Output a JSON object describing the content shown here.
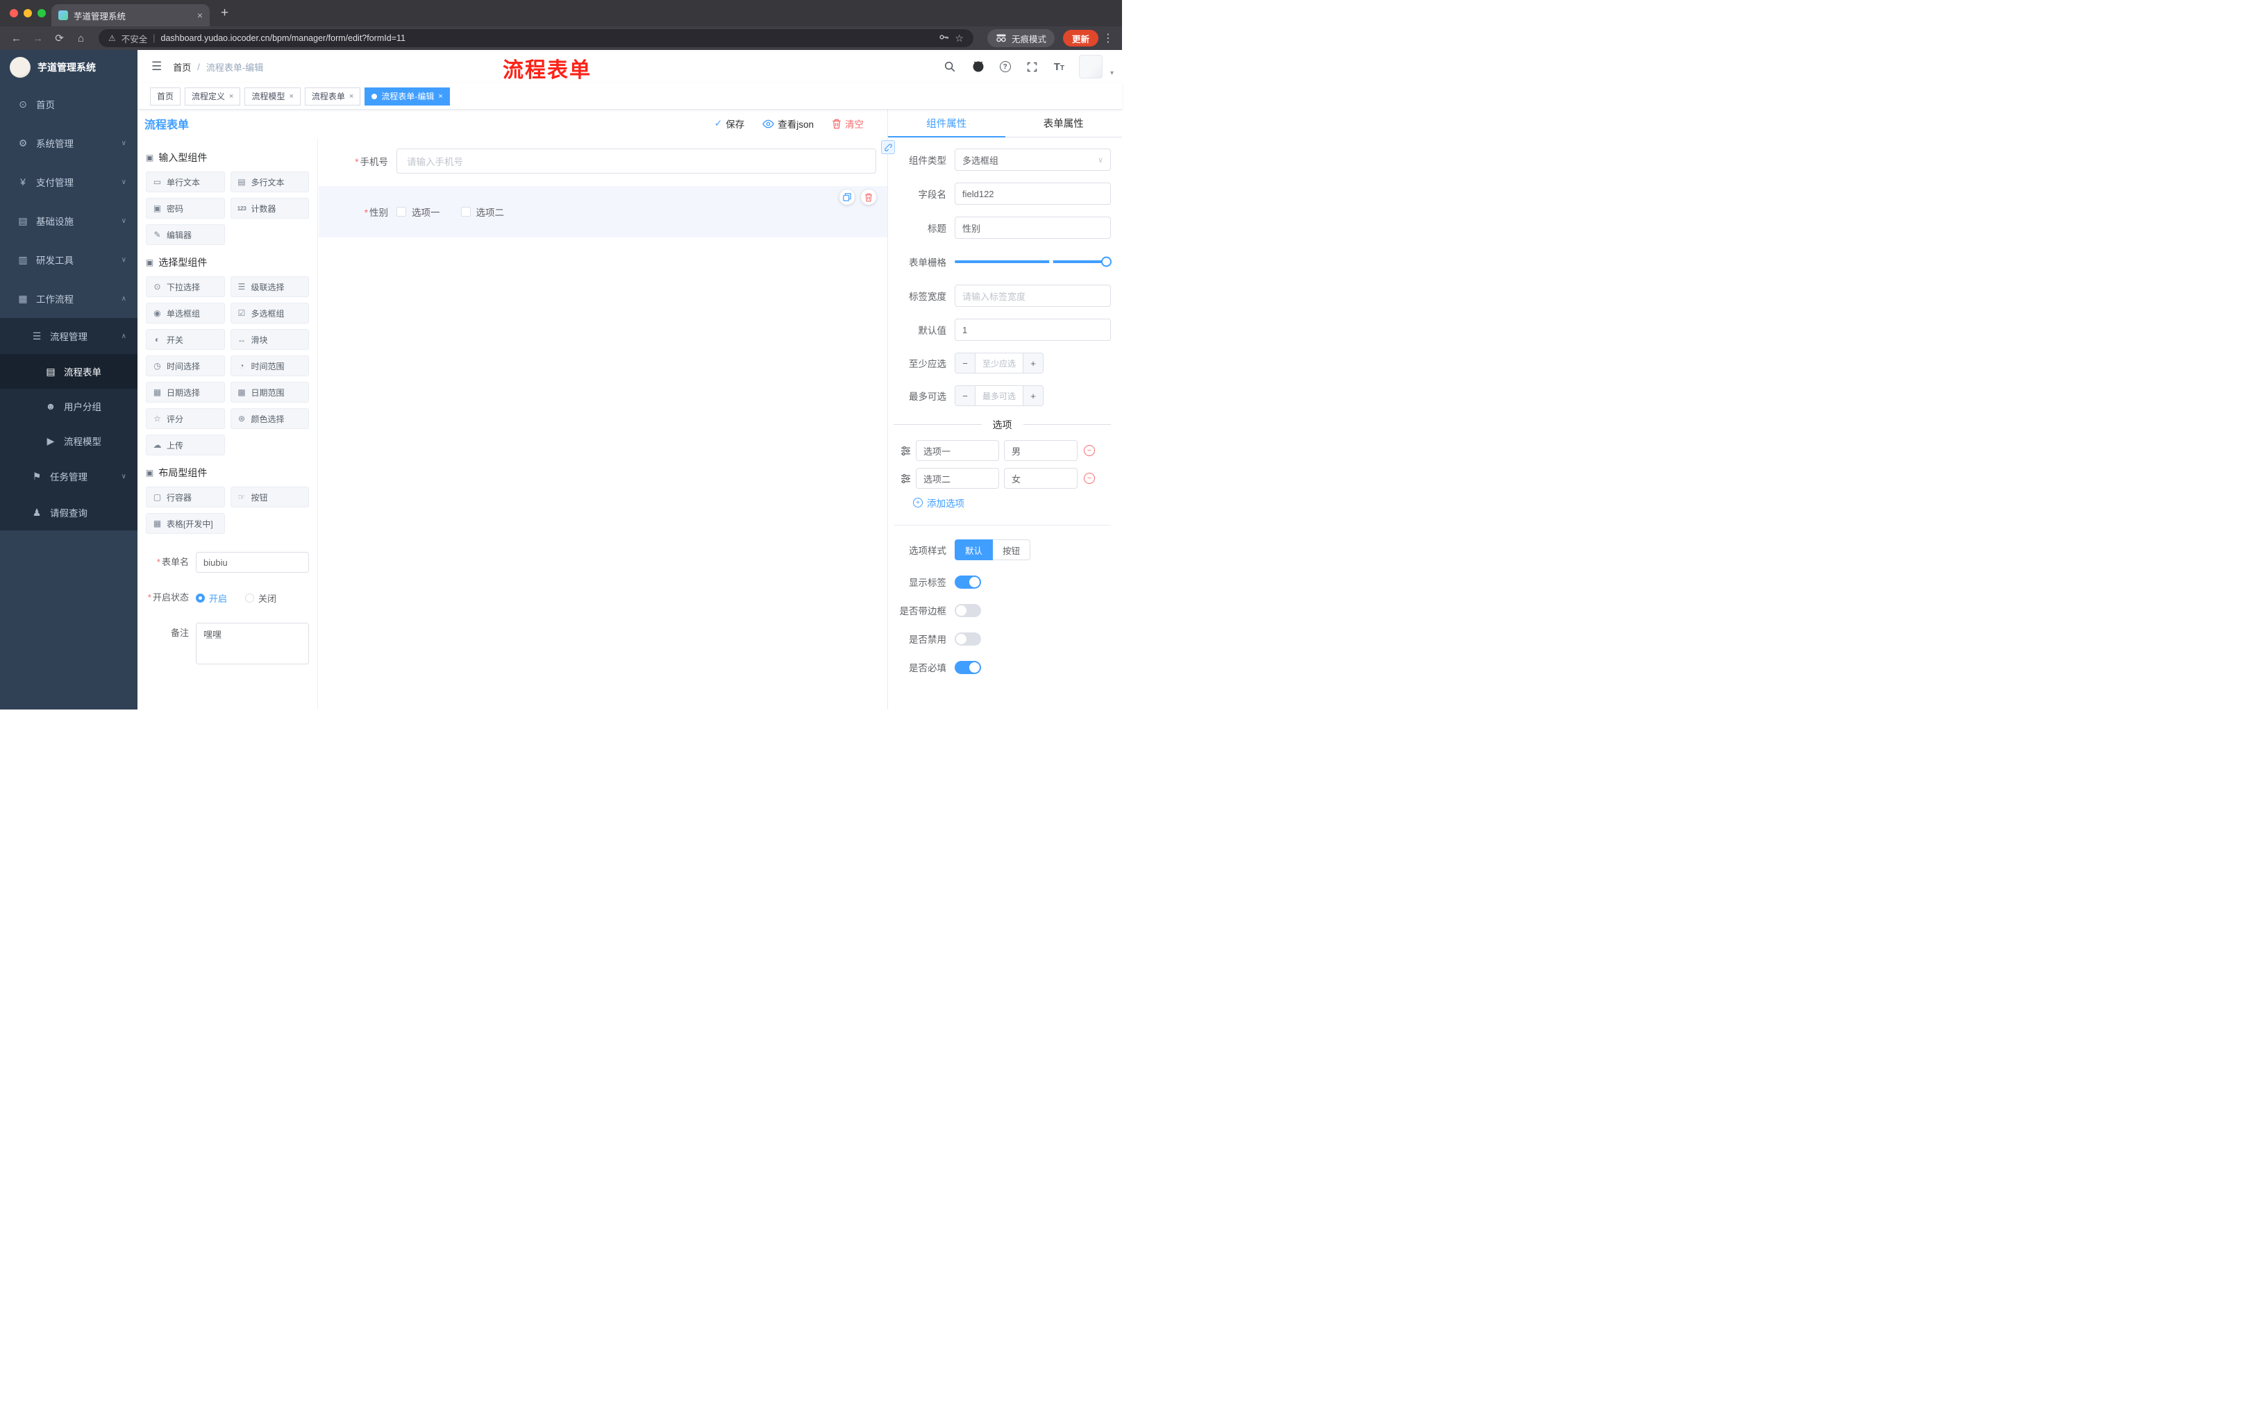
{
  "colors": {
    "accent": "#409eff",
    "danger": "#f56c6c",
    "annotation_red": "#fb2318",
    "sidebar_bg": "#304156"
  },
  "marks": {
    "required": "*",
    "minus": "−",
    "plus": "+",
    "close": "×",
    "pipe": "|",
    "chevron": "∨",
    "caret": "▾",
    "sep": "/"
  },
  "annotation": {
    "text": "流程表单"
  },
  "browser": {
    "tab_title": "芋道管理系统",
    "new_tab": "+",
    "back": "←",
    "forward": "→",
    "reload": "⟳",
    "home": "⌂",
    "warning_icon": "⚠",
    "warning_text": "不安全",
    "url": "dashboard.yudao.iocoder.cn/bpm/manager/form/edit?formId=11",
    "star": "☆",
    "incognito": "无痕模式",
    "update": "更新",
    "menu_dots": "⋮"
  },
  "sidebar": {
    "logo_title": "芋道管理系统",
    "items": [
      {
        "icon": "⊙",
        "label": "首页",
        "arrow": ""
      },
      {
        "icon": "⚙",
        "label": "系统管理",
        "arrow": "∨"
      },
      {
        "icon": "¥",
        "label": "支付管理",
        "arrow": "∨"
      },
      {
        "icon": "▤",
        "label": "基础设施",
        "arrow": "∨"
      },
      {
        "icon": "▥",
        "label": "研发工具",
        "arrow": "∨"
      },
      {
        "icon": "▦",
        "label": "工作流程",
        "arrow": "∧"
      },
      {
        "icon": "☰",
        "label": "流程管理",
        "arrow": "∧"
      },
      {
        "icon": "▤",
        "label": "流程表单",
        "arrow": ""
      },
      {
        "icon": "☻",
        "label": "用户分组",
        "arrow": ""
      },
      {
        "icon": "▶",
        "label": "流程模型",
        "arrow": ""
      },
      {
        "icon": "⚑",
        "label": "任务管理",
        "arrow": "∨"
      },
      {
        "icon": "♟",
        "label": "请假查询",
        "arrow": ""
      }
    ]
  },
  "header": {
    "hamburger": "☰",
    "breadcrumb_home": "首页",
    "breadcrumb_current": "流程表单-编辑",
    "help": "?",
    "font_big": "T",
    "font_small": "T"
  },
  "chips": [
    {
      "label": "首页"
    },
    {
      "label": "流程定义"
    },
    {
      "label": "流程模型"
    },
    {
      "label": "流程表单"
    },
    {
      "label": "流程表单-编辑"
    }
  ],
  "toolbar": {
    "title": "流程表单",
    "save_icon": "✓",
    "save": "保存",
    "view_json": "查看json",
    "clear": "清空"
  },
  "palette": {
    "sections": [
      {
        "title": "输入型组件",
        "items": [
          {
            "icon": "▭",
            "label": "单行文本"
          },
          {
            "icon": "▤",
            "label": "多行文本"
          },
          {
            "icon": "▣",
            "label": "密码"
          },
          {
            "icon": "123",
            "label": "计数器"
          },
          {
            "icon": "✎",
            "label": "编辑器"
          }
        ]
      },
      {
        "title": "选择型组件",
        "items": [
          {
            "icon": "⊙",
            "label": "下拉选择"
          },
          {
            "icon": "☰",
            "label": "级联选择"
          },
          {
            "icon": "◉",
            "label": "单选框组"
          },
          {
            "icon": "☑",
            "label": "多选框组"
          },
          {
            "icon": "◐",
            "label": "开关"
          },
          {
            "icon": "↔",
            "label": "滑块"
          },
          {
            "icon": "◷",
            "label": "时间选择"
          },
          {
            "icon": "◔",
            "label": "时间范围"
          },
          {
            "icon": "▦",
            "label": "日期选择"
          },
          {
            "icon": "▩",
            "label": "日期范围"
          },
          {
            "icon": "☆",
            "label": "评分"
          },
          {
            "icon": "⊛",
            "label": "颜色选择"
          },
          {
            "icon": "☁",
            "label": "上传"
          }
        ]
      },
      {
        "title": "布局型组件",
        "items": [
          {
            "icon": "▢",
            "label": "行容器"
          },
          {
            "icon": "☞",
            "label": "按钮"
          },
          {
            "icon": "▦",
            "label": "表格[开发中]"
          }
        ]
      }
    ]
  },
  "form_meta": {
    "name_label": "表单名",
    "name_value": "biubiu",
    "status_label": "开启状态",
    "status_on": "开启",
    "status_off": "关闭",
    "remark_label": "备注",
    "remark_value": "嘿嘿"
  },
  "canvas": {
    "phone_label": "手机号",
    "phone_placeholder": "请输入手机号",
    "gender_label": "性别",
    "gender_opt1": "选项一",
    "gender_opt2": "选项二"
  },
  "props": {
    "tab_component": "组件属性",
    "tab_form": "表单属性",
    "type_label": "组件类型",
    "type_value": "多选框组",
    "field_label": "字段名",
    "field_value": "field122",
    "title_label": "标题",
    "title_value": "性别",
    "grid_label": "表单栅格",
    "width_label": "标签宽度",
    "width_placeholder": "请输入标签宽度",
    "default_label": "默认值",
    "default_value": "1",
    "min_label": "至少应选",
    "min_placeholder": "至少应选",
    "max_label": "最多可选",
    "max_placeholder": "最多可选",
    "options_divider": "选项",
    "opt1_label": "选项一",
    "opt1_value": "男",
    "opt2_label": "选项二",
    "opt2_value": "女",
    "add_option": "添加选项",
    "style_label": "选项样式",
    "style_default": "默认",
    "style_button": "按钮",
    "show_label_label": "显示标签",
    "border_label": "是否带边框",
    "disabled_label": "是否禁用",
    "required_label": "是否必填"
  }
}
